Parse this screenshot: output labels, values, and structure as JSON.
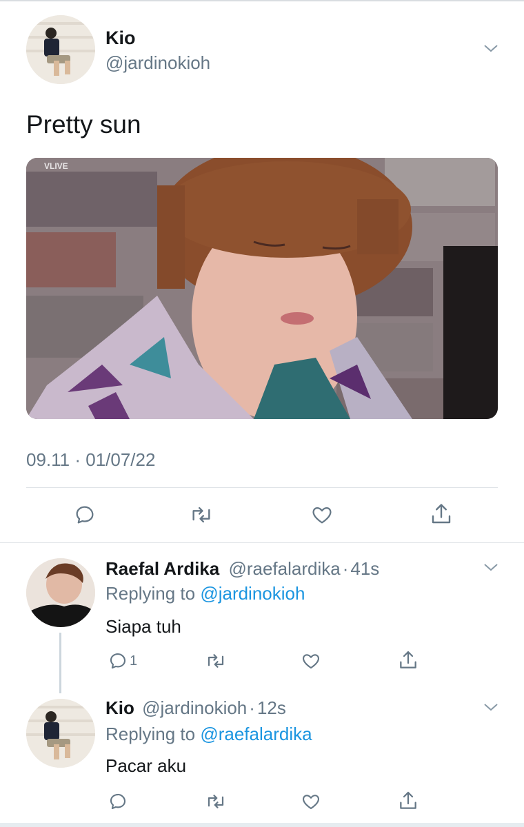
{
  "main_tweet": {
    "author_name": "Kio",
    "author_handle": "@jardinokioh",
    "text": "Pretty sun",
    "timestamp": "09.11 · 01/07/22",
    "media_watermark": "VLIVE",
    "actions": [
      "reply-icon",
      "retweet-icon",
      "like-icon",
      "share-icon"
    ]
  },
  "replies": [
    {
      "author_name": "Raefal Ardika",
      "author_handle": "@raefalardika",
      "separator": "·",
      "time": "41s",
      "replying_prefix": "Replying to",
      "replying_to": "@jardinokioh",
      "text": "Siapa tuh",
      "reply_count": "1"
    },
    {
      "author_name": "Kio",
      "author_handle": "@jardinokioh",
      "separator": "·",
      "time": "12s",
      "replying_prefix": "Replying to",
      "replying_to": "@raefalardika",
      "text": "Pacar aku",
      "reply_count": ""
    }
  ],
  "colors": {
    "link": "#1b95e0",
    "secondary_text": "#657786",
    "icon": "#657786"
  }
}
